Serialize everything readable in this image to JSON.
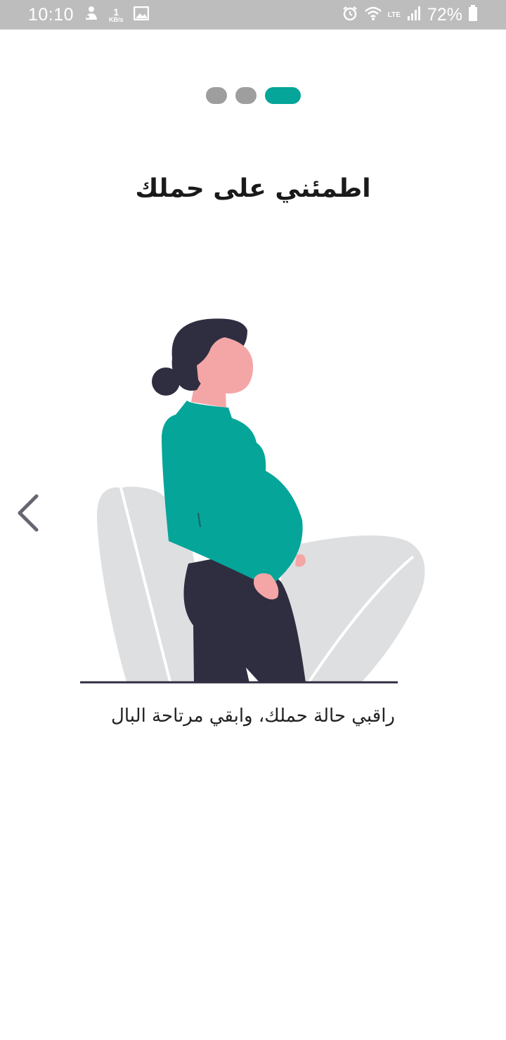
{
  "status_bar": {
    "time": "10:10",
    "net_speed_value": "1",
    "net_speed_unit": "KB/s",
    "lte_label": "LTE",
    "battery_percent": "72%",
    "left_icons": [
      "notification-person-icon",
      "image-icon"
    ],
    "right_icons": [
      "alarm-icon",
      "wifi-icon",
      "signal-icon",
      "battery-icon"
    ]
  },
  "onboarding": {
    "page_indicator": {
      "total": 3,
      "active_index": 2
    },
    "title": "اطمئني على حملك",
    "subtitle": "راقبي حالة حملك، وابقي مرتاحة البال",
    "prev_icon": "chevron-left-icon",
    "illustration": "pregnant-woman-illustration"
  },
  "colors": {
    "accent": "#05a599",
    "dot_inactive": "#9e9e9e",
    "status_bar_bg": "#bdbdbd",
    "figure_dark": "#2f2e41",
    "skin": "#f4a6a6",
    "chair": "#dedfe1",
    "arrow": "#666670"
  }
}
